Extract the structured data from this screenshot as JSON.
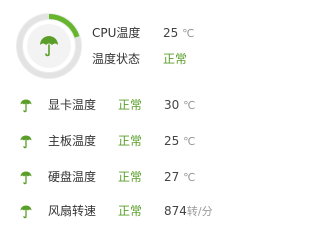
{
  "colors": {
    "ok": "#5a9e2a",
    "gauge_track": "#e8e8e8",
    "gauge_fill": "#66b52d",
    "icon": "#5a9e2a"
  },
  "gauge": {
    "icon": "umbrella-icon",
    "level": 0.2
  },
  "cpu": {
    "temp_label": "CPU温度",
    "temp_value": "25",
    "temp_unit": "℃",
    "state_label": "温度状态",
    "state_value": "正常"
  },
  "items": [
    {
      "icon": "umbrella-icon",
      "name": "显卡温度",
      "status": "正常",
      "value": "30",
      "unit": "℃"
    },
    {
      "icon": "umbrella-icon",
      "name": "主板温度",
      "status": "正常",
      "value": "25",
      "unit": "℃"
    },
    {
      "icon": "umbrella-icon",
      "name": "硬盘温度",
      "status": "正常",
      "value": "27",
      "unit": "℃"
    },
    {
      "icon": "umbrella-icon",
      "name": "风扇转速",
      "status": "正常",
      "value": "874",
      "unit": "转/分"
    }
  ]
}
